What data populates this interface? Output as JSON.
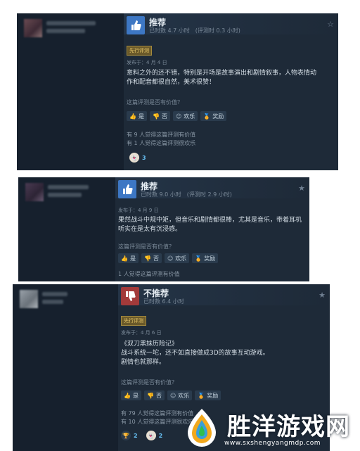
{
  "reviews": [
    {
      "verdict": "推荐",
      "hours": "已时数 4.7 小时　(评测时 0.3 小时)",
      "early_access": "先行评测",
      "posted": "发布于：4 月 4 日",
      "text": "意料之外的还不错，特别是开场是故事演出和剧情叙事，人物表情动作和配音都很自然，美术很赞！",
      "helpful_question": "这篇评测是否有价值？",
      "buttons": [
        "是",
        "否",
        "欢乐",
        "奖励"
      ],
      "stats": [
        "有 9 人觉得这篇评测有价值",
        "有 1 人觉得这篇评测很欢乐"
      ],
      "awards": [
        {
          "icon": "ghost-award-icon",
          "count": "3"
        }
      ]
    },
    {
      "verdict": "推荐",
      "hours": "已时数 9.0 小时　(评测时 2.9 小时)",
      "posted": "发布于：4 月 9 日",
      "text": "果然战斗中规中矩，但音乐和剧情都很棒，尤其是音乐，带着耳机听实在是太有沉浸感。",
      "helpful_question": "这篇评测是否有价值？",
      "buttons": [
        "是",
        "否",
        "欢乐",
        "奖励"
      ],
      "stats": [
        "1 人觉得这篇评测有价值"
      ]
    },
    {
      "verdict": "不推荐",
      "hours": "已时数 6.4 小时",
      "early_access": "先行评测",
      "posted": "发布于：4 月 6 日",
      "text_line1": "《双刀黑妹历险记》",
      "text_line2": "战斗系统一坨，还不如直接做成3D的故事互动游戏。",
      "text_line3": "剧情也就那样。",
      "helpful_question": "这篇评测是否有价值？",
      "buttons": [
        "是",
        "否",
        "欢乐",
        "奖励"
      ],
      "stats": [
        "有 79 人觉得这篇评测有价值",
        "有 10 人觉得这篇评测很欢乐"
      ],
      "awards": [
        {
          "icon": "trophy-award-icon",
          "count": "2"
        },
        {
          "icon": "ghost-award-icon",
          "count": "2"
        }
      ]
    }
  ],
  "watermark": {
    "title": "胜洋游戏网",
    "url": "www.sxshengyangmdp.com"
  },
  "colors": {
    "background": "#1b2838",
    "positive": "#3d77c4",
    "negative": "#a33a3a",
    "link": "#66c0f4"
  }
}
